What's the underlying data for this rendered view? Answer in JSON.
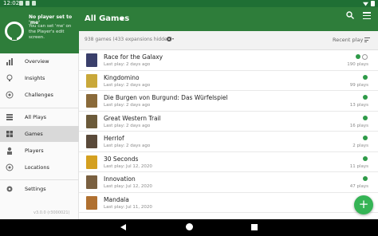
{
  "status": {
    "time": "12:02"
  },
  "drawer": {
    "title": "No player set to 'me'",
    "subtitle": "You can set 'me' on the Player's edit screen.",
    "items": [
      {
        "label": "Overview",
        "icon": "bar-chart-icon"
      },
      {
        "label": "Insights",
        "icon": "lightbulb-icon"
      },
      {
        "label": "Challenges",
        "icon": "target-icon"
      },
      {
        "label": "All Plays",
        "icon": "list-icon"
      },
      {
        "label": "Games",
        "icon": "grid-icon",
        "active": true
      },
      {
        "label": "Players",
        "icon": "person-icon"
      },
      {
        "label": "Locations",
        "icon": "location-icon"
      },
      {
        "label": "Settings",
        "icon": "gear-icon"
      }
    ],
    "version": "v3.0.0 (r3000021)"
  },
  "appbar": {
    "title": "All Games"
  },
  "subbar": {
    "count": "938 games (433 expansions hidden)",
    "sort": "Recent play"
  },
  "games": [
    {
      "name": "Race for the Galaxy",
      "last": "Last play: 2 days ago",
      "plays": "190 plays",
      "color": "#3a3f6b"
    },
    {
      "name": "Kingdomino",
      "last": "Last play: 2 days ago",
      "plays": "99 plays",
      "color": "#c9a83a"
    },
    {
      "name": "Die Burgen von Burgund: Das Würfelspiel",
      "last": "Last play: 2 days ago",
      "plays": "13 plays",
      "color": "#8a6a3a"
    },
    {
      "name": "Great Western Trail",
      "last": "Last play: 2 days ago",
      "plays": "16 plays",
      "color": "#6b5a3a"
    },
    {
      "name": "Herrlof",
      "last": "Last play: 2 days ago",
      "plays": "2 plays",
      "color": "#5a4a3a"
    },
    {
      "name": "30 Seconds",
      "last": "Last play: Jul 12, 2020",
      "plays": "11 plays",
      "color": "#d4a020"
    },
    {
      "name": "Innovation",
      "last": "Last play: Jul 12, 2020",
      "plays": "47 plays",
      "color": "#7a6040"
    },
    {
      "name": "Mandala",
      "last": "Last play: Jul 11, 2020",
      "plays": "",
      "color": "#b07030"
    }
  ],
  "colors": {
    "primary": "#2e7d3a",
    "accent": "#35b455",
    "status": "#1f6f34"
  }
}
